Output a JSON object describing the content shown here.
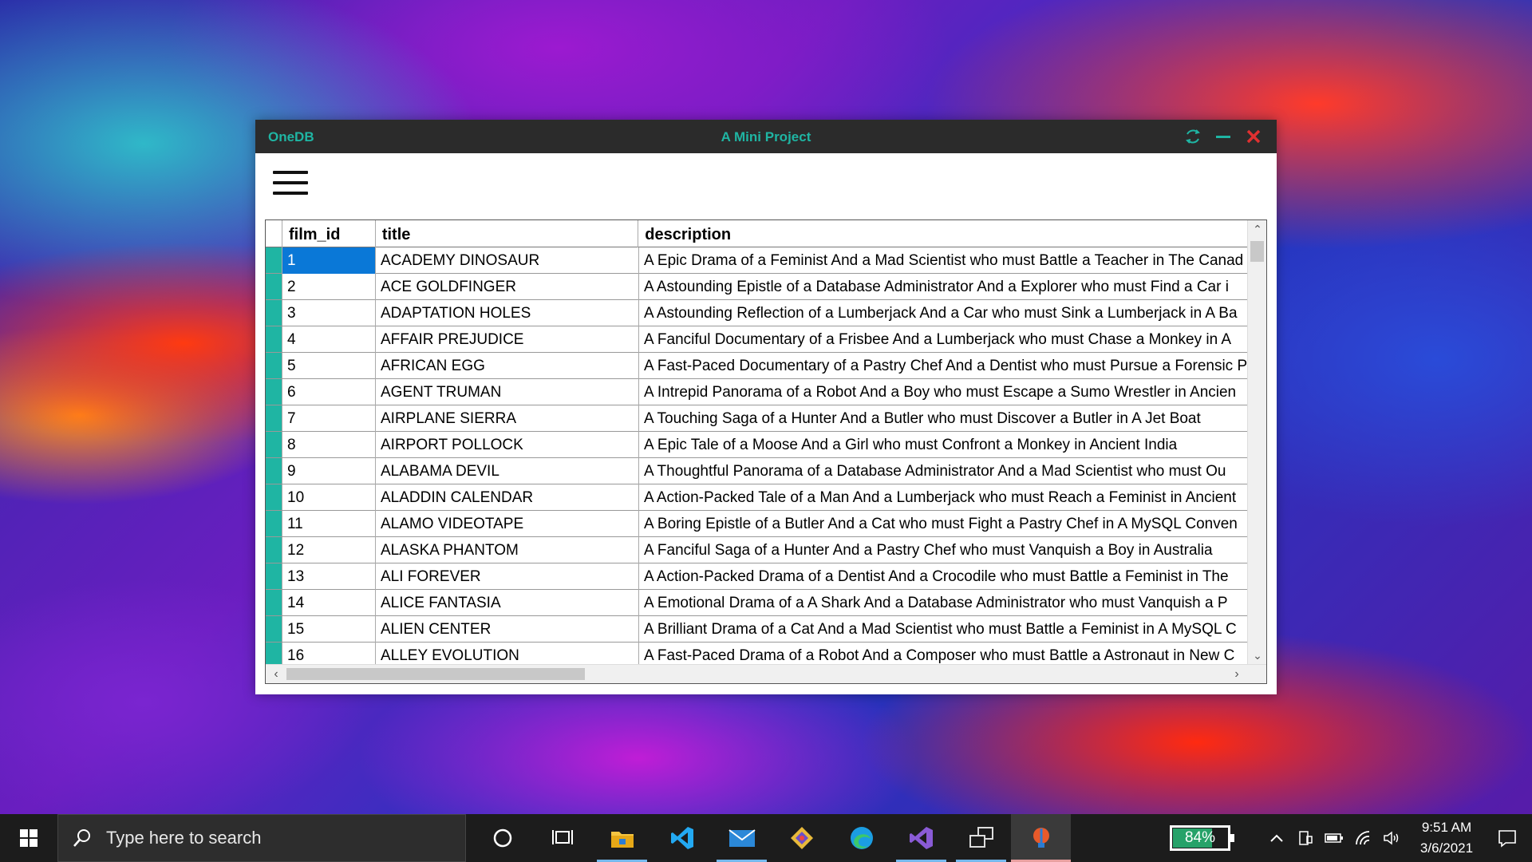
{
  "window": {
    "app_name": "OneDB",
    "title": "A Mini Project"
  },
  "grid": {
    "columns": [
      "film_id",
      "title",
      "description"
    ],
    "rows": [
      {
        "film_id": "1",
        "title": "ACADEMY DINOSAUR",
        "description": "A Epic Drama of a Feminist And a Mad Scientist who must Battle a Teacher in The Canad"
      },
      {
        "film_id": "2",
        "title": "ACE GOLDFINGER",
        "description": "A Astounding Epistle of a Database Administrator And a Explorer who must Find a Car i"
      },
      {
        "film_id": "3",
        "title": "ADAPTATION HOLES",
        "description": "A Astounding Reflection of a Lumberjack And a Car who must Sink a Lumberjack in A Ba"
      },
      {
        "film_id": "4",
        "title": "AFFAIR PREJUDICE",
        "description": "A Fanciful Documentary of a Frisbee And a Lumberjack who must Chase a Monkey in A"
      },
      {
        "film_id": "5",
        "title": "AFRICAN EGG",
        "description": "A Fast-Paced Documentary of a Pastry Chef And a Dentist who must Pursue a Forensic P"
      },
      {
        "film_id": "6",
        "title": "AGENT TRUMAN",
        "description": "A Intrepid Panorama of a Robot And a Boy who must Escape a Sumo Wrestler in Ancien"
      },
      {
        "film_id": "7",
        "title": "AIRPLANE SIERRA",
        "description": "A Touching Saga of a Hunter And a Butler who must Discover a Butler in A Jet Boat"
      },
      {
        "film_id": "8",
        "title": "AIRPORT POLLOCK",
        "description": "A Epic Tale of a Moose And a Girl who must Confront a Monkey in Ancient India"
      },
      {
        "film_id": "9",
        "title": "ALABAMA DEVIL",
        "description": "A Thoughtful Panorama of a Database Administrator And a Mad Scientist who must Ou"
      },
      {
        "film_id": "10",
        "title": "ALADDIN CALENDAR",
        "description": "A Action-Packed Tale of a Man And a Lumberjack who must Reach a Feminist in Ancient"
      },
      {
        "film_id": "11",
        "title": "ALAMO VIDEOTAPE",
        "description": "A Boring Epistle of a Butler And a Cat who must Fight a Pastry Chef in A MySQL Conven"
      },
      {
        "film_id": "12",
        "title": "ALASKA PHANTOM",
        "description": "A Fanciful Saga of a Hunter And a Pastry Chef who must Vanquish a Boy in Australia"
      },
      {
        "film_id": "13",
        "title": "ALI FOREVER",
        "description": "A Action-Packed Drama of a Dentist And a Crocodile who must Battle a Feminist in The"
      },
      {
        "film_id": "14",
        "title": "ALICE FANTASIA",
        "description": "A Emotional Drama of a A Shark And a Database Administrator who must Vanquish a P"
      },
      {
        "film_id": "15",
        "title": "ALIEN CENTER",
        "description": "A Brilliant Drama of a Cat And a Mad Scientist who must Battle a Feminist in A MySQL C"
      },
      {
        "film_id": "16",
        "title": "ALLEY EVOLUTION",
        "description": "A Fast-Paced Drama of a Robot And a Composer who must Battle a Astronaut in New C"
      }
    ]
  },
  "taskbar": {
    "search_placeholder": "Type here to search",
    "apps": [
      "cortana-icon",
      "task-view-icon",
      "file-explorer-icon",
      "vscode-icon",
      "mail-icon",
      "git-icon",
      "edge-icon",
      "visual-studio-icon",
      "remote-desktop-icon",
      "app-active-icon"
    ],
    "battery_percent": "84%",
    "time": "9:51 AM",
    "date": "3/6/2021"
  },
  "colors": {
    "accent": "#1fb5a3",
    "selection": "#0a78d7",
    "titlebar": "#2b2b2b",
    "close": "#e03030"
  }
}
